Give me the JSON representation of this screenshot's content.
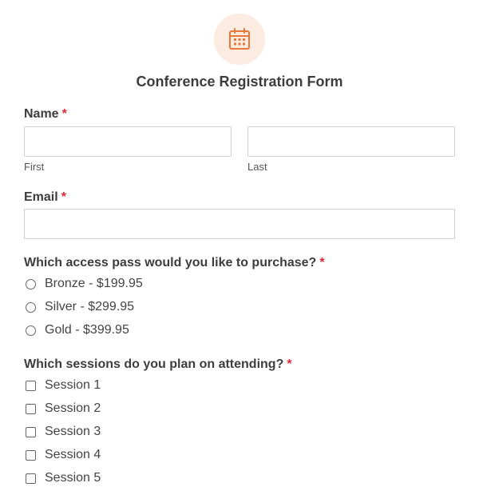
{
  "header": {
    "icon": "calendar-icon",
    "icon_color": "#e8783a",
    "icon_bg": "#fcebe1",
    "title": "Conference Registration Form"
  },
  "required_marker": "*",
  "required_color": "#e0273a",
  "name_field": {
    "label": "Name",
    "first": {
      "value": "",
      "sublabel": "First"
    },
    "last": {
      "value": "",
      "sublabel": "Last"
    }
  },
  "email_field": {
    "label": "Email",
    "value": ""
  },
  "access_pass": {
    "question": "Which access pass would you like to purchase?",
    "options": [
      "Bronze - $199.95",
      "Silver - $299.95",
      "Gold - $399.95"
    ]
  },
  "sessions": {
    "question": "Which sessions do you plan on attending?",
    "options": [
      "Session 1",
      "Session 2",
      "Session 3",
      "Session 4",
      "Session 5"
    ]
  }
}
